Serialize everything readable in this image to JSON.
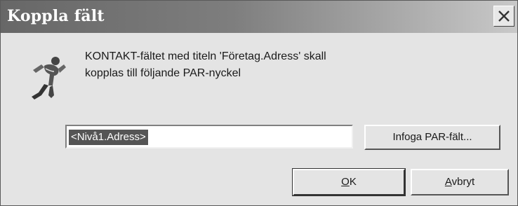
{
  "window": {
    "title": "Koppla fält"
  },
  "message": {
    "line1": "KONTAKT-fältet med titeln 'Företag.Adress' skall",
    "line2": "kopplas till följande PAR-nyckel"
  },
  "field": {
    "value": "<Nivå1.Adress>"
  },
  "buttons": {
    "insert_label": "Infoga PAR-fält...",
    "ok_mnemonic": "O",
    "ok_rest": "K",
    "cancel_mnemonic": "A",
    "cancel_rest": "vbryt"
  },
  "icons": {
    "close": "close-icon",
    "linker": "figure-icon"
  }
}
